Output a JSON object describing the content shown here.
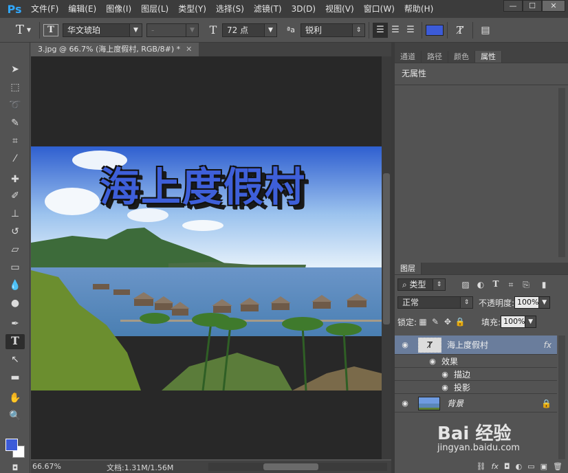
{
  "app": {
    "logo": "Ps"
  },
  "menu": [
    "文件(F)",
    "编辑(E)",
    "图像(I)",
    "图层(L)",
    "类型(Y)",
    "选择(S)",
    "滤镜(T)",
    "3D(D)",
    "视图(V)",
    "窗口(W)",
    "帮助(H)"
  ],
  "window_buttons": {
    "minimize": "—",
    "restore": "☐",
    "close": "✕"
  },
  "options": {
    "tool_glyph": "T",
    "font_family": "华文琥珀",
    "font_style": "-",
    "size_glyph": "T",
    "font_size": "72 点",
    "aa_label": "ªa",
    "antialias": "锐利",
    "text_color": "#3c5bd8"
  },
  "document": {
    "tab_title": "3.jpg @ 66.7% (海上度假村, RGB/8#) *",
    "tab_close": "✕",
    "headline": "海上度假村"
  },
  "status": {
    "zoom": "66.67%",
    "doc_info": "文档:1.31M/1.56M"
  },
  "properties_panel": {
    "tabs": [
      "通道",
      "路径",
      "颜色",
      "属性"
    ],
    "active_tab": "属性",
    "empty_text": "无属性"
  },
  "layers_panel": {
    "tab": "图层",
    "filter_label": "类型",
    "blend_mode": "正常",
    "opacity_label": "不透明度:",
    "opacity_value": "100%",
    "lock_label": "锁定:",
    "fill_label": "填充:",
    "fill_value": "100%",
    "layers": [
      {
        "name": "海上度假村",
        "fx": "fx",
        "effects_label": "效果",
        "effects": [
          "描边",
          "投影"
        ]
      },
      {
        "name": "背景"
      }
    ]
  },
  "watermark": {
    "brand": "Bai 经验",
    "url": "jingyan.baidu.com"
  },
  "colors": {
    "foreground": "#3c5bd8",
    "background": "#ffffff",
    "ui_dark": "#535353",
    "selected_layer": "#6a7d9c"
  }
}
